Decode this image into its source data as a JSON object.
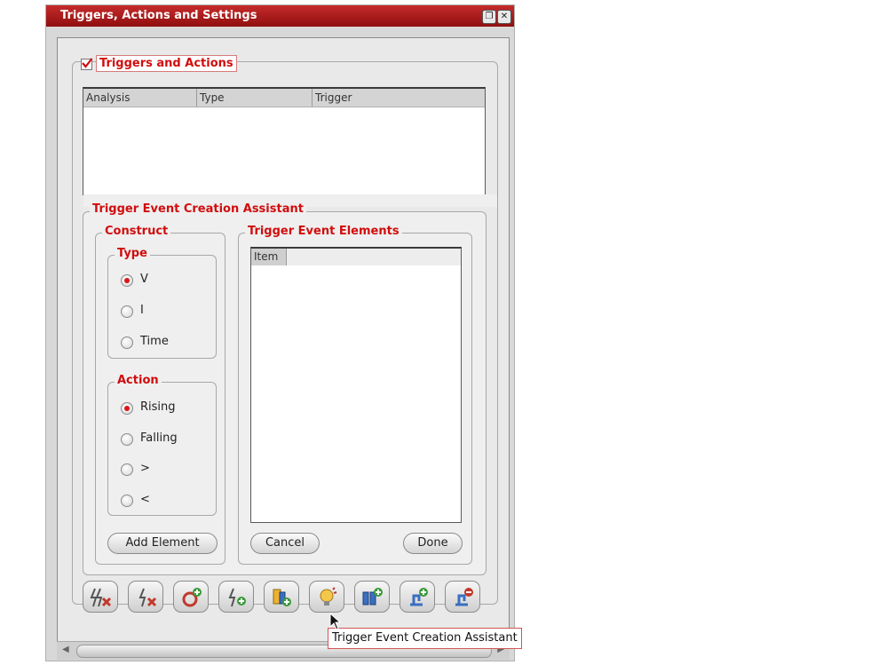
{
  "window": {
    "title": "Triggers, Actions and Settings"
  },
  "triggers_actions": {
    "label": "Triggers and Actions",
    "checked": true,
    "columns": [
      "Analysis",
      "Type",
      "Trigger"
    ]
  },
  "assistant": {
    "label": "Trigger Event Creation Assistant",
    "construct": {
      "label": "Construct",
      "type": {
        "label": "Type",
        "options": [
          {
            "label": "V",
            "selected": true
          },
          {
            "label": "I",
            "selected": false
          },
          {
            "label": "Time",
            "selected": false
          }
        ]
      },
      "action": {
        "label": "Action",
        "options": [
          {
            "label": "Rising",
            "selected": true
          },
          {
            "label": "Falling",
            "selected": false
          },
          {
            "label": ">",
            "selected": false
          },
          {
            "label": "<",
            "selected": false
          }
        ]
      },
      "add_button": "Add Element"
    },
    "elements": {
      "label": "Trigger Event Elements",
      "column": "Item",
      "cancel_button": "Cancel",
      "done_button": "Done"
    }
  },
  "toolbar": {
    "buttons": [
      {
        "icon": "delete-all-triggers-icon"
      },
      {
        "icon": "delete-trigger-icon"
      },
      {
        "icon": "add-setting-icon"
      },
      {
        "icon": "add-trigger-icon"
      },
      {
        "icon": "add-action-icon"
      },
      {
        "icon": "trigger-assistant-icon"
      },
      {
        "icon": "add-parameter-icon"
      },
      {
        "icon": "add-probe-icon"
      },
      {
        "icon": "remove-probe-icon"
      }
    ]
  },
  "tooltip": {
    "text": "Trigger Event Creation Assistant"
  },
  "colors": {
    "accent": "#d10d0d",
    "titlebar": "#b01c1c",
    "panel": "#e9e9e9"
  }
}
